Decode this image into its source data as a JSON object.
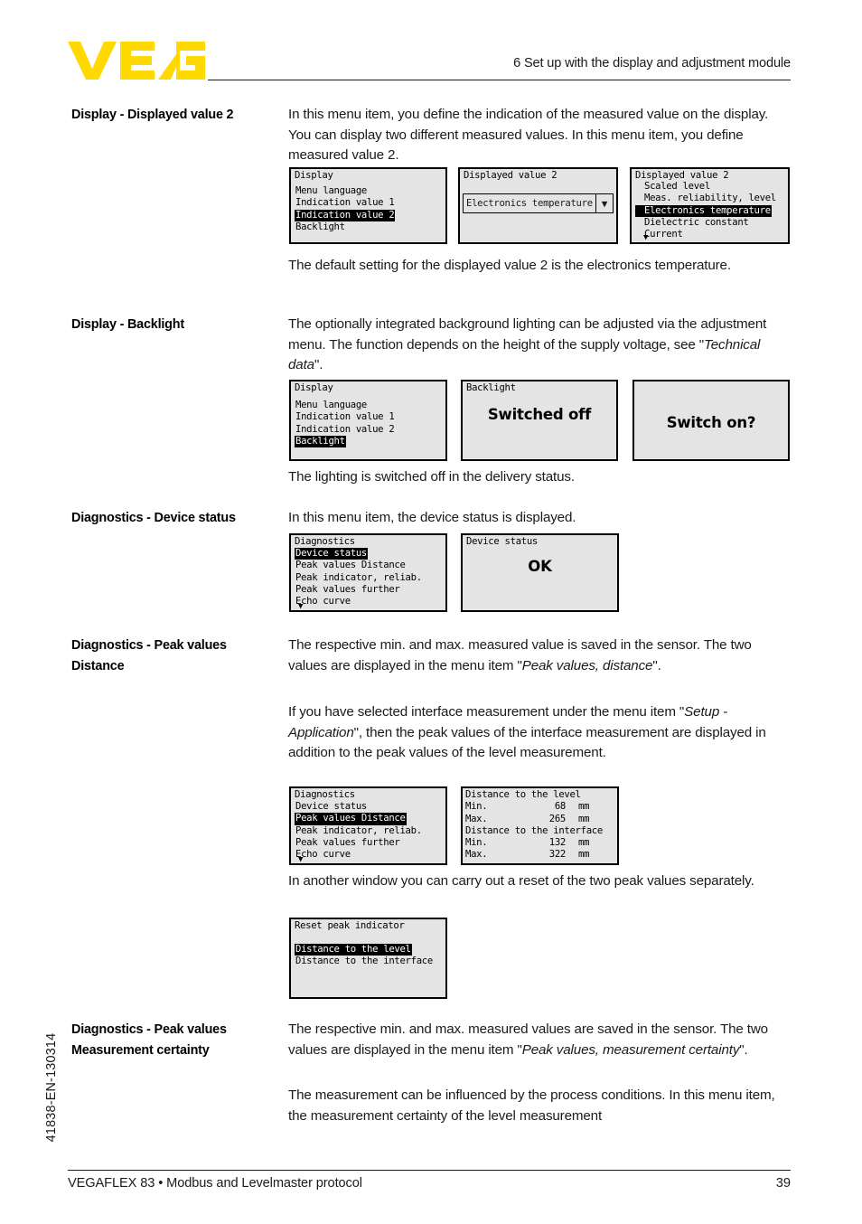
{
  "header": {
    "logo_alt": "VEGA",
    "logo_color": "#FFD900",
    "chapter_title": "6 Set up with the display and adjustment module"
  },
  "side": {
    "doc_number": "41838-EN-130314"
  },
  "footer": {
    "product_line": "VEGAFLEX 83 • Modbus and Levelmaster protocol",
    "page_number": "39"
  },
  "sections": [
    {
      "label": "Display - Displayed value 2",
      "paragraphs": [
        "In this menu item, you define the indication of the measured value on the display. You can display two different measured values. In this menu item, you define measured value 2.",
        "The default setting for the displayed value 2 is the electronics temperature."
      ]
    },
    {
      "label": "Display - Backlight",
      "paragraphs": [
        "The optionally integrated background lighting can be adjusted via the adjustment menu. The function depends on the height of the supply voltage, see \"Technical data\".",
        "The lighting is switched off in the delivery status."
      ]
    },
    {
      "label": "Diagnostics - Device status",
      "paragraphs": [
        "In this menu item, the device status is displayed."
      ]
    },
    {
      "label": "Diagnostics - Peak values Distance",
      "paragraphs": [
        "The respective min. and max. measured value is saved in the sensor. The two values are displayed in the menu item \"Peak values, distance\".",
        "If you have selected interface measurement under the menu item \"Setup - Application\", then the peak values of the interface measurement are displayed in addition to the peak values of the level measurement.",
        "In another window you can carry out a reset of the two peak values separately."
      ]
    },
    {
      "label": "Diagnostics - Peak values Measurement certainty",
      "paragraphs": [
        "The respective min. and max. measured values are saved in the sensor. The two values are displayed in the menu item \"Peak values, measurement certainty\".",
        "The measurement can be influenced by the process conditions. In this menu item, the measurement certainty of the level measurement"
      ]
    }
  ],
  "screens": {
    "display_menu_1": {
      "title": "Display",
      "items": [
        {
          "label": "Menu language",
          "selected": false
        },
        {
          "label": "Indication value 1",
          "selected": false
        },
        {
          "label": "Indication value 2",
          "selected": true
        },
        {
          "label": "Backlight",
          "selected": false
        }
      ]
    },
    "displayed_value_2_dropdown": {
      "title": "Displayed value 2",
      "value": "Electronics temperature",
      "arrow_icon": "▼"
    },
    "displayed_value_2_list": {
      "title": "Displayed value 2",
      "items": [
        {
          "label": "Scaled level",
          "selected": false,
          "checked": false
        },
        {
          "label": "Meas. reliability, level",
          "selected": false,
          "checked": false
        },
        {
          "label": "Electronics temperature",
          "selected": true,
          "checked": true
        },
        {
          "label": "Dielectric constant",
          "selected": false,
          "checked": false
        },
        {
          "label": "Current",
          "selected": false,
          "checked": false
        }
      ],
      "scroll_down_icon": "▼"
    },
    "display_menu_2": {
      "title": "Display",
      "items": [
        {
          "label": "Menu language",
          "selected": false
        },
        {
          "label": "Indication value 1",
          "selected": false
        },
        {
          "label": "Indication value 2",
          "selected": false
        },
        {
          "label": "Backlight",
          "selected": true
        }
      ]
    },
    "backlight_status": {
      "title": "Backlight",
      "value": "Switched off"
    },
    "backlight_prompt": {
      "title": "",
      "value": "Switch on?"
    },
    "diagnostics_menu_1": {
      "title": "Diagnostics",
      "items": [
        {
          "label": "Device status",
          "selected": true
        },
        {
          "label": "Peak values Distance",
          "selected": false
        },
        {
          "label": "Peak indicator, reliab.",
          "selected": false
        },
        {
          "label": "Peak values further",
          "selected": false
        },
        {
          "label": "Echo curve",
          "selected": false
        }
      ],
      "scroll_down_icon": "▼"
    },
    "device_status": {
      "title": "Device status",
      "value": "OK"
    },
    "diagnostics_menu_2": {
      "title": "Diagnostics",
      "items": [
        {
          "label": "Device status",
          "selected": false
        },
        {
          "label": "Peak values Distance",
          "selected": true
        },
        {
          "label": "Peak indicator, reliab.",
          "selected": false
        },
        {
          "label": "Peak values further",
          "selected": false
        },
        {
          "label": "Echo curve",
          "selected": false
        }
      ],
      "scroll_down_icon": "▼"
    },
    "peak_values_distance": {
      "groups": [
        {
          "heading": "Distance to the level",
          "rows": [
            {
              "label": "Min.",
              "value": "68",
              "unit": "mm"
            },
            {
              "label": "Max.",
              "value": "265",
              "unit": "mm"
            }
          ]
        },
        {
          "heading": "Distance to the interface",
          "rows": [
            {
              "label": "Min.",
              "value": "132",
              "unit": "mm"
            },
            {
              "label": "Max.",
              "value": "322",
              "unit": "mm"
            }
          ]
        }
      ]
    },
    "reset_peak_indicator": {
      "title": "Reset peak indicator",
      "items": [
        {
          "label": "Distance to the level",
          "selected": true
        },
        {
          "label": "Distance to the interface",
          "selected": false
        }
      ]
    }
  }
}
